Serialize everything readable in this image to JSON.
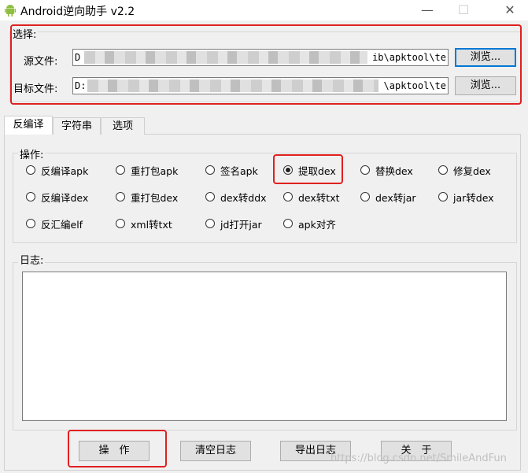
{
  "window": {
    "title": "Android逆向助手 v2.2",
    "minimize_glyph": "—",
    "maximize_glyph": "☐",
    "close_glyph": "✕"
  },
  "select": {
    "label": "选择:",
    "source_label": "源文件:",
    "source_value_start": "D",
    "source_value_end": "ib\\apktool\\te",
    "target_label": "目标文件:",
    "target_value_start": "D:",
    "target_value_end": "\\apktool\\te",
    "browse_label": "浏览..."
  },
  "tabs": [
    "反编译",
    "字符串",
    "选项"
  ],
  "operations": {
    "label": "操作:",
    "selected": "提取dex",
    "rows": [
      [
        "反编译apk",
        "重打包apk",
        "签名apk",
        "提取dex",
        "替换dex",
        "修复dex"
      ],
      [
        "反编译dex",
        "重打包dex",
        "dex转ddx",
        "dex转txt",
        "dex转jar",
        "jar转dex"
      ],
      [
        "反汇编elf",
        "xml转txt",
        "jd打开jar",
        "apk对齐"
      ]
    ]
  },
  "log": {
    "label": "日志:",
    "content": ""
  },
  "buttons": {
    "operate": "操　作",
    "clear_log": "清空日志",
    "export_log": "导出日志",
    "about": "关　于"
  },
  "watermark": "https://blog.csdn.net/SmileAndFun",
  "colors": {
    "highlight_red": "#e02020",
    "focus_blue": "#0078d7"
  }
}
